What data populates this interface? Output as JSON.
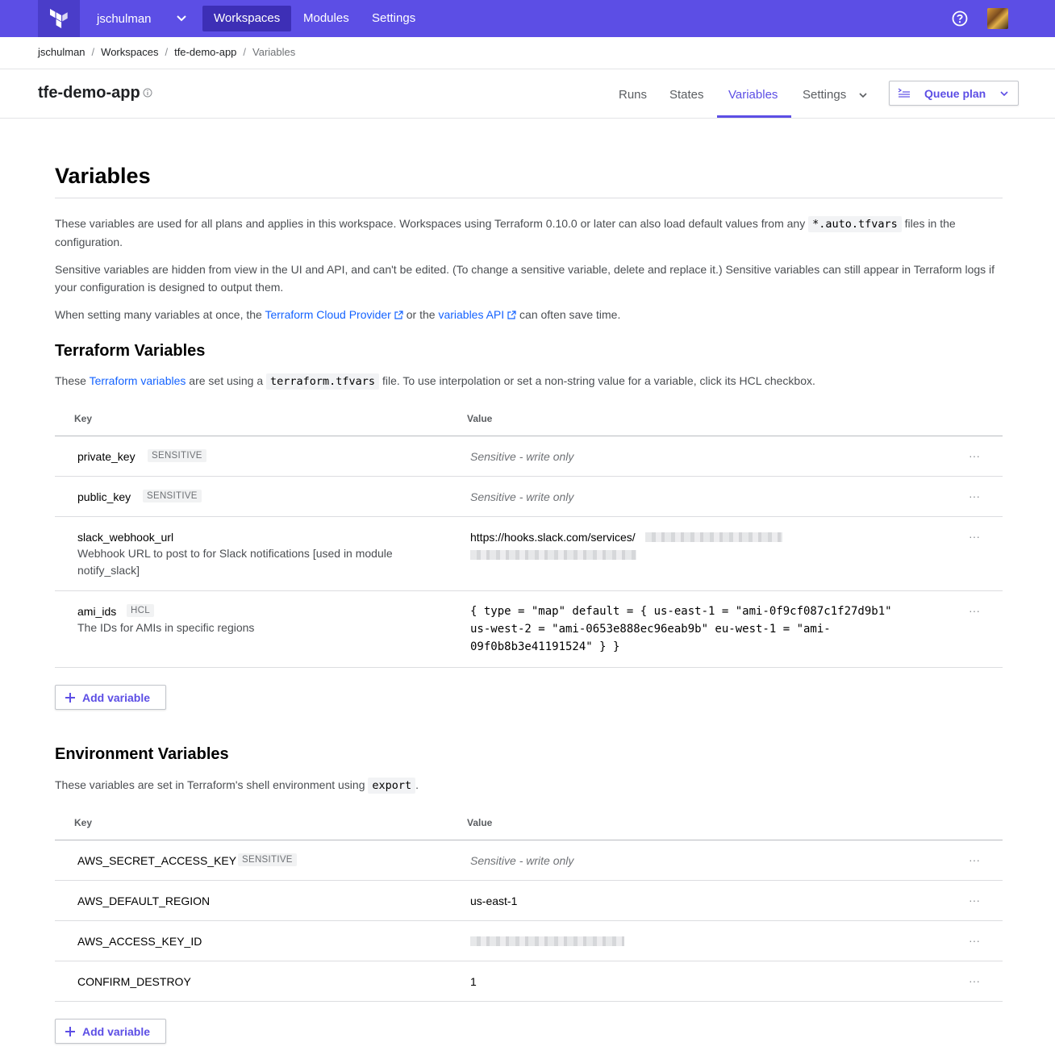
{
  "nav": {
    "org": "jschulman",
    "links": [
      "Workspaces",
      "Modules",
      "Settings"
    ],
    "icons": {
      "logo": "terraform-logo-icon",
      "org_chevron": "chevron-down-icon",
      "help": "help-icon",
      "avatar": "user-avatar"
    }
  },
  "breadcrumb": [
    "jschulman",
    "Workspaces",
    "tfe-demo-app",
    "Variables"
  ],
  "workspace": {
    "name": "tfe-demo-app",
    "tabs": [
      "Runs",
      "States",
      "Variables",
      "Settings"
    ],
    "active_tab": "Variables",
    "queue_plan": "Queue plan"
  },
  "page": {
    "title": "Variables",
    "intro1_a": "These variables are used for all plans and applies in this workspace. Workspaces using Terraform 0.10.0 or later can also load default values from any",
    "intro1_code": "*.auto.tfvars",
    "intro1_b": "files in the configuration.",
    "intro2": "Sensitive variables are hidden from view in the UI and API, and can't be edited. (To change a sensitive variable, delete and replace it.) Sensitive variables can still appear in Terraform logs if your configuration is designed to output them.",
    "intro3_a": "When setting many variables at once, the",
    "intro3_link1": "Terraform Cloud Provider",
    "intro3_b": "or the",
    "intro3_link2": "variables API",
    "intro3_c": "can often save time."
  },
  "terraform_vars": {
    "title": "Terraform Variables",
    "desc_a": "These",
    "desc_link": "Terraform variables",
    "desc_b": "are set using a",
    "desc_code": "terraform.tfvars",
    "desc_c": "file. To use interpolation or set a non-string value for a variable, click its HCL checkbox.",
    "col_key": "Key",
    "col_value": "Value",
    "rows": [
      {
        "key": "private_key",
        "badge": "SENSITIVE",
        "value": "Sensitive - write only"
      },
      {
        "key": "public_key",
        "badge": "SENSITIVE",
        "value": "Sensitive - write only"
      },
      {
        "key": "slack_webhook_url",
        "description": "Webhook URL to post to for Slack notifications [used in module notify_slack]",
        "value": "https://hooks.slack.com/services/"
      },
      {
        "key": "ami_ids",
        "badge": "HCL",
        "description": "The IDs for AMIs in specific regions",
        "value": "{ type = \"map\" default = { us-east-1 = \"ami-0f9cf087c1f27d9b1\" us-west-2 = \"ami-0653e888ec96eab9b\" eu-west-1 = \"ami-09f0b8b3e41191524\" } }"
      }
    ],
    "add": "Add variable"
  },
  "env_vars": {
    "title": "Environment Variables",
    "desc_a": "These variables are set in Terraform's shell environment using",
    "desc_code": "export",
    "desc_b": ".",
    "col_key": "Key",
    "col_value": "Value",
    "rows": [
      {
        "key": "AWS_SECRET_ACCESS_KEY",
        "badge": "SENSITIVE",
        "value": "Sensitive - write only"
      },
      {
        "key": "AWS_DEFAULT_REGION",
        "value": "us-east-1"
      },
      {
        "key": "AWS_ACCESS_KEY_ID",
        "value": ""
      },
      {
        "key": "CONFIRM_DESTROY",
        "value": "1"
      }
    ],
    "add": "Add variable"
  },
  "row_menu": "···",
  "colors": {
    "brand": "#5c4ee5",
    "link": "#1563ff"
  }
}
